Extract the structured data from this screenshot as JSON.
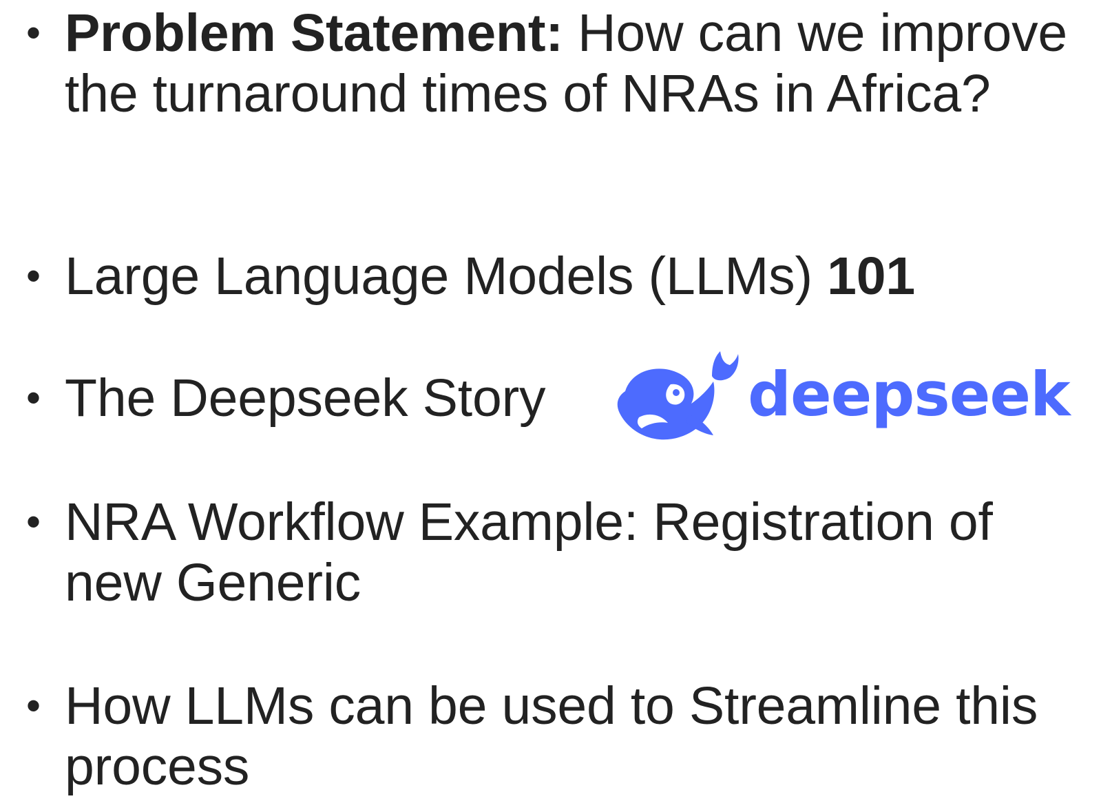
{
  "bullets": [
    {
      "bold_prefix": "Problem Statement:",
      "text": " How can we improve the turnaround times of NRAs in Africa?"
    },
    {
      "text": "Large Language Models (LLMs) ",
      "bold_suffix": "101"
    },
    {
      "text": "The Deepseek Story"
    },
    {
      "text": "NRA Workflow Example: Registration of new Generic"
    },
    {
      "text": "How LLMs can be used to Streamline this process"
    }
  ],
  "bullet_symbol": "•",
  "logo": {
    "wordmark": "deepseek",
    "icon": "whale-icon",
    "color": "#4d6bfe"
  }
}
